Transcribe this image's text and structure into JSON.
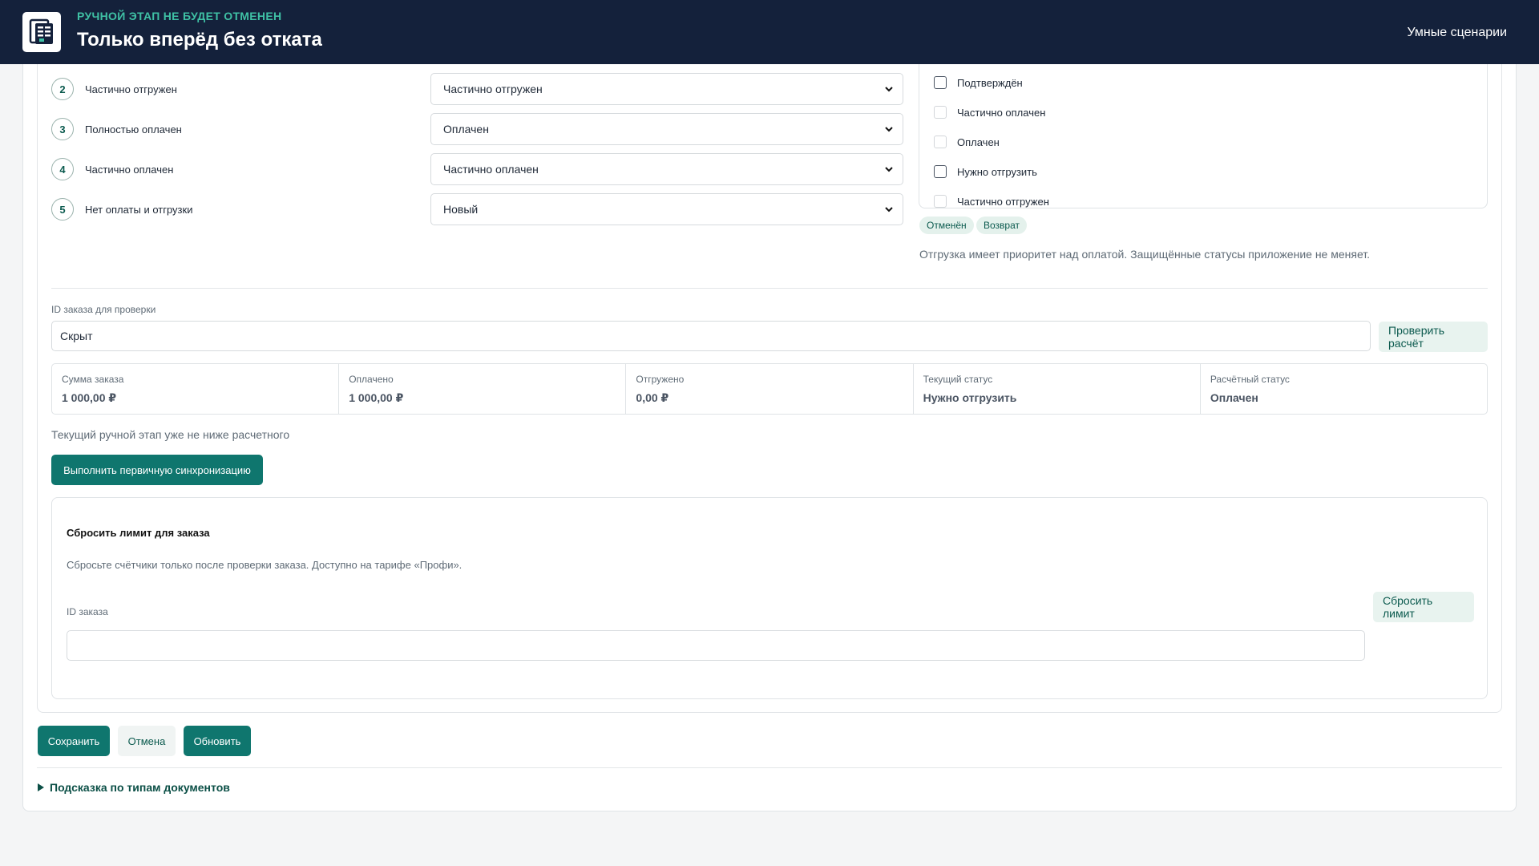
{
  "header": {
    "subtitle": "РУЧНОЙ ЭТАП НЕ БУДЕТ ОТМЕНЕН",
    "title": "Только вперёд без отката",
    "nav_link": "Умные сценарии"
  },
  "rules": [
    {
      "num": "2",
      "label": "Частично отгружен",
      "selected": "Частично отгружен"
    },
    {
      "num": "3",
      "label": "Полностью оплачен",
      "selected": "Оплачен"
    },
    {
      "num": "4",
      "label": "Частично оплачен",
      "selected": "Частично оплачен"
    },
    {
      "num": "5",
      "label": "Нет оплаты и отгрузки",
      "selected": "Новый"
    }
  ],
  "statuses": [
    {
      "label": "Подтверждён",
      "disabled": false
    },
    {
      "label": "Частично оплачен",
      "disabled": true
    },
    {
      "label": "Оплачен",
      "disabled": true
    },
    {
      "label": "Нужно отгрузить",
      "disabled": false
    },
    {
      "label": "Частично отгружен",
      "disabled": true
    }
  ],
  "protected_chips": [
    "Отменён",
    "Возврат"
  ],
  "priority_hint": "Отгрузка имеет приоритет над оплатой. Защищённые статусы приложение не меняет.",
  "check": {
    "label": "ID заказа для проверки",
    "value": "Скрыт",
    "button": "Проверить расчёт"
  },
  "stats": [
    {
      "key": "Сумма заказа",
      "value": "1 000,00 ₽"
    },
    {
      "key": "Оплачено",
      "value": "1 000,00 ₽"
    },
    {
      "key": "Отгружено",
      "value": "0,00 ₽"
    },
    {
      "key": "Текущий статус",
      "value": "Нужно отгрузить"
    },
    {
      "key": "Расчётный статус",
      "value": "Оплачен"
    }
  ],
  "check_result": "Текущий ручной этап уже не ниже расчетного",
  "sync_button": "Выполнить первичную синхронизацию",
  "reset": {
    "title": "Сбросить лимит для заказа",
    "description": "Сбросьте счётчики только после проверки заказа. Доступно на тарифе «Профи».",
    "field_label": "ID заказа",
    "field_value": "",
    "button": "Сбросить лимит"
  },
  "actions": {
    "save": "Сохранить",
    "cancel": "Отмена",
    "refresh": "Обновить"
  },
  "tip": "Подсказка по типам документов"
}
